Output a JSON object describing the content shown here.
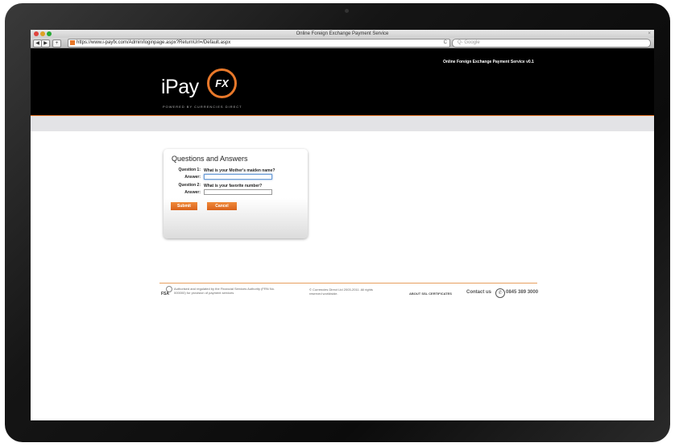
{
  "browser": {
    "window_title": "Online Foreign Exchange Payment Service",
    "url": "https://www.i-payfx.com/Admin/loginpage.aspx?ReturnUrl=/Default.aspx",
    "search_placeholder": "Q- Google",
    "back_label": "◀",
    "forward_label": "▶",
    "add_label": "+",
    "reload_label": "C",
    "close_label": "×"
  },
  "header": {
    "service_title": "Online Foreign Exchange Payment Service v0.1",
    "logo_main": "iPay",
    "logo_badge": "FX",
    "logo_tagline": "POWERED BY CURRENCIES DIRECT"
  },
  "form": {
    "title": "Questions and Answers",
    "question1_label": "Question 1:",
    "question1_text": "What is your Mother's maiden name?",
    "answer1_label": "Answer:",
    "answer1_value": "",
    "question2_label": "Question 2:",
    "question2_text": "What is your favorite number?",
    "answer2_label": "Answer:",
    "answer2_value": "",
    "submit_label": "Submit",
    "cancel_label": "Cancel"
  },
  "footer": {
    "fsa_label": "FSA",
    "regulation_text": "Authorised and regulated by the Financial Services Authority (FRN No. 000000) for provision of payment services",
    "copyright_text": "© Currencies Direct Ltd 2003-2011. All rights reserved worldwide.",
    "ssl_text": "ABOUT SSL CERTIFICATES",
    "contact_label": "Contact us",
    "phone_icon_glyph": "✆",
    "phone_number": "0845 389 3000"
  },
  "colors": {
    "accent": "#e8782a",
    "header_bg": "#000000"
  }
}
